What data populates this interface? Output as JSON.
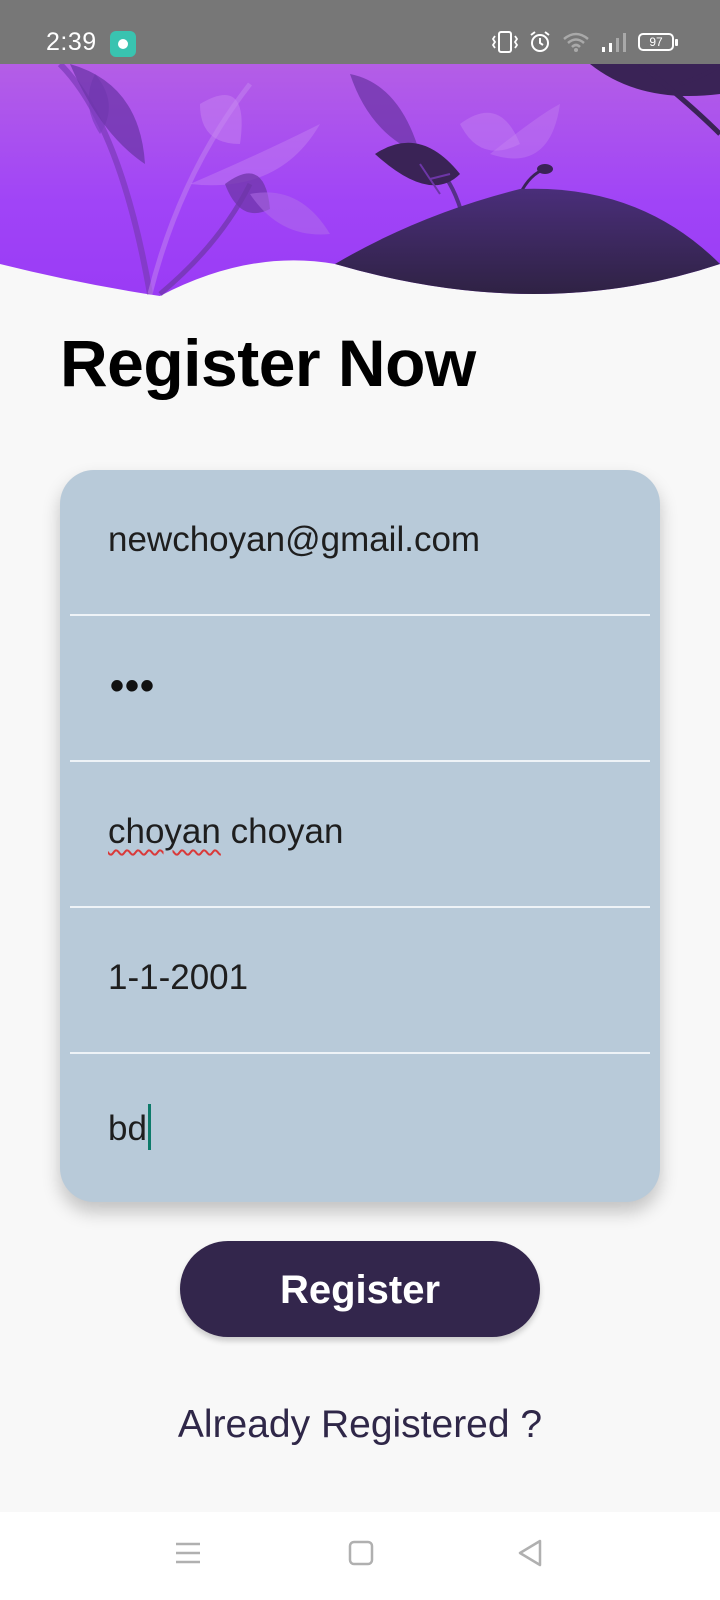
{
  "status_bar": {
    "time": "2:39",
    "battery": "97",
    "icons": [
      "app-notification-icon",
      "vibrate-icon",
      "alarm-icon",
      "wifi-icon",
      "signal-icon",
      "battery-icon"
    ]
  },
  "header": {
    "title": "Register Now"
  },
  "form": {
    "email": "newchoyan@gmail.com",
    "password": "•••",
    "name_first": "choyan",
    "name_rest": " choyan",
    "dob": "1-1-2001",
    "country": "bd"
  },
  "actions": {
    "register_label": "Register",
    "already_label": "Already Registered ?"
  },
  "nav_bar": {
    "icons": [
      "menu-icon",
      "home-square-icon",
      "back-triangle-icon"
    ]
  },
  "colors": {
    "header_purple": "#a244f2",
    "dark_purple": "#33264c",
    "card": "#b8cad9",
    "background": "#f8f8f8",
    "status_bar": "#777777"
  }
}
